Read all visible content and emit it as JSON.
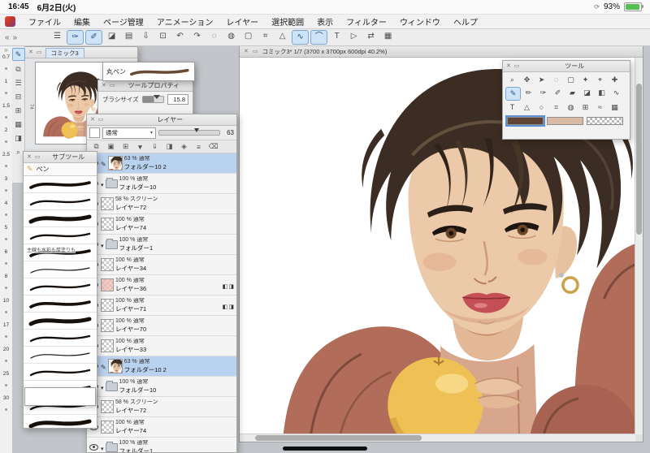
{
  "chrome": {
    "close": "✕",
    "min": "▭"
  },
  "status_bar": {
    "time": "16:45",
    "date": "6月2日(火)",
    "battery_percent": "93%",
    "status_glyph": "⟳"
  },
  "menu": {
    "items": [
      {
        "name": "menu-file",
        "label": "ファイル"
      },
      {
        "name": "menu-edit",
        "label": "編集"
      },
      {
        "name": "menu-page-manage",
        "label": "ページ管理"
      },
      {
        "name": "menu-animation",
        "label": "アニメーション"
      },
      {
        "name": "menu-layer",
        "label": "レイヤー"
      },
      {
        "name": "menu-selection",
        "label": "選択範囲"
      },
      {
        "name": "menu-view",
        "label": "表示"
      },
      {
        "name": "menu-filter",
        "label": "フィルター"
      },
      {
        "name": "menu-window",
        "label": "ウィンドウ"
      },
      {
        "name": "menu-help",
        "label": "ヘルプ"
      }
    ]
  },
  "toolbar": {
    "collapse_left": "«",
    "collapse_right": "»",
    "icons": [
      {
        "name": "workspace-menu-icon",
        "glyph": "☰"
      },
      {
        "name": "pen-tool-icon",
        "glyph": "✑",
        "_class": "active"
      },
      {
        "name": "brush-tool-icon",
        "glyph": "✐",
        "_class": "active"
      },
      {
        "name": "eraser-tool-icon",
        "glyph": "◪"
      },
      {
        "name": "open-file-icon",
        "glyph": "▤"
      },
      {
        "name": "save-file-icon",
        "glyph": "⇩"
      },
      {
        "name": "export-icon",
        "glyph": "⊡"
      },
      {
        "name": "undo-icon",
        "glyph": "↶"
      },
      {
        "name": "redo-icon",
        "glyph": "↷"
      },
      {
        "name": "select-circle-icon",
        "glyph": "◌"
      },
      {
        "name": "deselect-icon",
        "glyph": "◍"
      },
      {
        "name": "crop-icon",
        "glyph": "▢"
      },
      {
        "name": "snap-icon",
        "glyph": "⌗"
      },
      {
        "name": "figure-icon",
        "glyph": "△"
      },
      {
        "name": "polyline-tool-icon",
        "glyph": "∿",
        "_class": "active"
      },
      {
        "name": "curve-tool-icon",
        "glyph": "⌒",
        "_class": "active"
      },
      {
        "name": "text-tool-icon",
        "glyph": "T"
      },
      {
        "name": "play-icon",
        "glyph": "▷"
      },
      {
        "name": "flip-icon",
        "glyph": "⇄"
      },
      {
        "name": "grid-icon",
        "glyph": "▦"
      }
    ]
  },
  "left_dock": {
    "sizes": [
      {
        "name": "brush-size-0-7",
        "label": "0.7"
      },
      {
        "name": "brush-size-1",
        "label": "1"
      },
      {
        "name": "brush-size-1-5",
        "label": "1.5"
      },
      {
        "name": "brush-size-2",
        "label": "2"
      },
      {
        "name": "brush-size-2-5",
        "label": "2.5"
      },
      {
        "name": "brush-size-3",
        "label": "3"
      },
      {
        "name": "brush-size-4",
        "label": "4"
      },
      {
        "name": "brush-size-5",
        "label": "5"
      },
      {
        "name": "brush-size-6",
        "label": "6"
      },
      {
        "name": "brush-size-8",
        "label": "8"
      },
      {
        "name": "brush-size-10",
        "label": "10"
      },
      {
        "name": "brush-size-17",
        "label": "17"
      },
      {
        "name": "brush-size-20",
        "label": "20"
      },
      {
        "name": "brush-size-25",
        "label": "25"
      },
      {
        "name": "brush-size-30",
        "label": "30"
      }
    ],
    "command_icons": [
      {
        "name": "edit-pen-icon",
        "glyph": "✎",
        "_class": "active"
      },
      {
        "name": "panel-page-icon",
        "glyph": "⧉"
      },
      {
        "name": "panel-story-icon",
        "glyph": "☰"
      },
      {
        "name": "panel-copy-icon",
        "glyph": "⊟"
      },
      {
        "name": "panel-paste-icon",
        "glyph": "⊞"
      },
      {
        "name": "panel-grid-icon",
        "glyph": "▦"
      },
      {
        "name": "panel-mask-icon",
        "glyph": "◨"
      },
      {
        "name": "panel-search-icon",
        "glyph": "⌕"
      }
    ]
  },
  "navigator": {
    "tab_label": "コミック3",
    "side_label": "74"
  },
  "brush_popup": {
    "tool_name": "丸ペン"
  },
  "tool_property": {
    "title": "ツールプロパティ",
    "brush_size_label": "ブラシサイズ",
    "brush_size_value": "15.8"
  },
  "subtool": {
    "title": "サブツール",
    "group_label": "ペン",
    "brushes": [
      {
        "_class": "w3",
        "label": ""
      },
      {
        "_class": "w2",
        "label": ""
      },
      {
        "_class": "w4",
        "label": ""
      },
      {
        "_class": "w2",
        "label": ""
      },
      {
        "_class": "w3",
        "label": "主線も水彩も厚塗りも"
      },
      {
        "_class": "w1",
        "label": ""
      },
      {
        "_class": "w2",
        "label": ""
      },
      {
        "_class": "w3",
        "label": ""
      },
      {
        "_class": "w4",
        "label": ""
      },
      {
        "_class": "w2",
        "label": ""
      },
      {
        "_class": "w1",
        "label": ""
      },
      {
        "_class": "w2",
        "label": ""
      },
      {
        "_class": "w3",
        "label": ""
      },
      {
        "_class": "w2",
        "label": ""
      },
      {
        "_class": "w4",
        "label": ""
      }
    ]
  },
  "layer_panel": {
    "title": "レイヤー",
    "blend_mode": "通常",
    "blend_caret": "▾",
    "opacity_value": "63",
    "command_icons": [
      {
        "name": "clip-mask-icon",
        "glyph": "⧉"
      },
      {
        "name": "new-layer-icon",
        "glyph": "▣"
      },
      {
        "name": "new-folder-icon",
        "glyph": "⊞"
      },
      {
        "name": "transfer-down-icon",
        "glyph": "▼"
      },
      {
        "name": "combine-down-icon",
        "glyph": "⇓"
      },
      {
        "name": "layer-mask-icon",
        "glyph": "◨"
      },
      {
        "name": "lock-layer-icon",
        "glyph": "◈"
      },
      {
        "name": "layer-settings-icon",
        "glyph": "≡"
      },
      {
        "name": "delete-layer-icon",
        "glyph": "⌫"
      }
    ],
    "rows": [
      {
        "info": "63 % 通常",
        "name_label": "フォルダー10 2",
        "_class": "selected",
        "pencil": true,
        "is_portrait": true
      },
      {
        "info": "100 % 通常",
        "name_label": "フォルダー10",
        "folder": true,
        "caret": true
      },
      {
        "info": "58 % スクリーン",
        "name_label": "レイヤー72",
        "is_checker": true
      },
      {
        "info": "100 % 通常",
        "name_label": "レイヤー74",
        "is_checker": true
      },
      {
        "info": "100 % 通常",
        "name_label": "フォルダー1",
        "folder": true,
        "caret": true
      },
      {
        "info": "100 % 通常",
        "name_label": "レイヤー34",
        "is_checker": true
      },
      {
        "info": "100 % 通常",
        "name_label": "レイヤー36",
        "is_pink": true,
        "badges": true
      },
      {
        "info": "100 % 通常",
        "name_label": "レイヤー71",
        "is_checker": true,
        "badges": true
      },
      {
        "info": "100 % 通常",
        "name_label": "レイヤー70",
        "is_checker": true
      },
      {
        "info": "100 % 通常",
        "name_label": "レイヤー33",
        "is_checker": true
      },
      {
        "info": "63 % 通常",
        "name_label": "フォルダー10 2",
        "_class": "selected",
        "pencil": true,
        "is_portrait": true
      },
      {
        "info": "100 % 通常",
        "name_label": "フォルダー10",
        "folder": true,
        "caret": true
      },
      {
        "info": "58 % スクリーン",
        "name_label": "レイヤー72",
        "is_checker": true
      },
      {
        "info": "100 % 通常",
        "name_label": "レイヤー74",
        "is_checker": true
      },
      {
        "info": "100 % 通常",
        "name_label": "フォルダー1",
        "folder": true,
        "caret": true
      }
    ]
  },
  "canvas_window": {
    "title": "コミック3* 1/7 (3700 x 3700px 600dpi 40.2%)"
  },
  "tool_panel": {
    "title": "ツール",
    "tools": [
      {
        "name": "zoom-tool-icon",
        "glyph": "⌕"
      },
      {
        "name": "move-tool-icon",
        "glyph": "✥"
      },
      {
        "name": "object-tool-icon",
        "glyph": "➤"
      },
      {
        "name": "lasso-tool-icon",
        "glyph": "◌"
      },
      {
        "name": "marquee-tool-icon",
        "glyph": "▢"
      },
      {
        "name": "wand-tool-icon",
        "glyph": "✦"
      },
      {
        "name": "eyedropper-tool-icon",
        "glyph": "⌖"
      },
      {
        "name": "operation-tool-icon",
        "glyph": "✚"
      },
      {
        "name": "pen-tool-icon",
        "glyph": "✎",
        "_class": "active"
      },
      {
        "name": "pencil-tool-icon",
        "glyph": "✏"
      },
      {
        "name": "brush-tool-icon",
        "glyph": "✑"
      },
      {
        "name": "watercolor-tool-icon",
        "glyph": "✐"
      },
      {
        "name": "decoration-tool-icon",
        "glyph": "▰"
      },
      {
        "name": "eraser-tool-icon",
        "glyph": "◪"
      },
      {
        "name": "blend-tool-icon",
        "glyph": "◧"
      },
      {
        "name": "correction-tool-icon",
        "glyph": "∿"
      },
      {
        "name": "text-tool-icon",
        "glyph": "T"
      },
      {
        "name": "figure-tool-icon",
        "glyph": "△"
      },
      {
        "name": "balloon-tool-icon",
        "glyph": "○"
      },
      {
        "name": "frame-border-tool-icon",
        "glyph": "⌗"
      },
      {
        "name": "gradient-tool-icon",
        "glyph": "◍"
      },
      {
        "name": "fill-tool-icon",
        "glyph": "⊞"
      },
      {
        "name": "liquify-tool-icon",
        "glyph": "≈"
      },
      {
        "name": "grid-tool-icon",
        "glyph": "▦"
      }
    ],
    "swatches": {
      "main_hex": "#5d4434",
      "sub_hex": "#d9b9a2"
    }
  }
}
